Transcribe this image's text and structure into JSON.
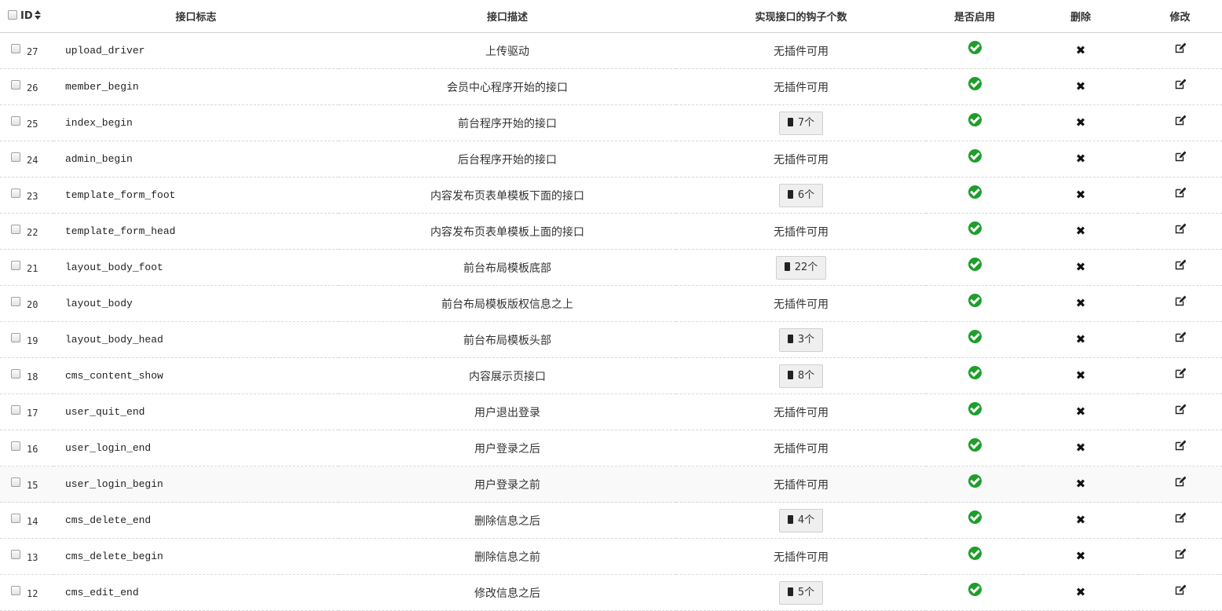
{
  "headers": {
    "id": "ID",
    "mark": "接口标志",
    "desc": "接口描述",
    "hooks": "实现接口的钩子个数",
    "enabled": "是否启用",
    "delete": "删除",
    "edit": "修改"
  },
  "rows": [
    {
      "id": "27",
      "mark": "upload_driver",
      "desc": "上传驱动",
      "hooks": "无插件可用",
      "hook_button": false,
      "enabled": true
    },
    {
      "id": "26",
      "mark": "member_begin",
      "desc": "会员中心程序开始的接口",
      "hooks": "无插件可用",
      "hook_button": false,
      "enabled": true
    },
    {
      "id": "25",
      "mark": "index_begin",
      "desc": "前台程序开始的接口",
      "hooks": "7个",
      "hook_button": true,
      "enabled": true
    },
    {
      "id": "24",
      "mark": "admin_begin",
      "desc": "后台程序开始的接口",
      "hooks": "无插件可用",
      "hook_button": false,
      "enabled": true
    },
    {
      "id": "23",
      "mark": "template_form_foot",
      "desc": "内容发布页表单模板下面的接口",
      "hooks": "6个",
      "hook_button": true,
      "enabled": true
    },
    {
      "id": "22",
      "mark": "template_form_head",
      "desc": "内容发布页表单模板上面的接口",
      "hooks": "无插件可用",
      "hook_button": false,
      "enabled": true
    },
    {
      "id": "21",
      "mark": "layout_body_foot",
      "desc": "前台布局模板底部",
      "hooks": "22个",
      "hook_button": true,
      "enabled": true
    },
    {
      "id": "20",
      "mark": "layout_body",
      "desc": "前台布局模板版权信息之上",
      "hooks": "无插件可用",
      "hook_button": false,
      "enabled": true
    },
    {
      "id": "19",
      "mark": "layout_body_head",
      "desc": "前台布局模板头部",
      "hooks": "3个",
      "hook_button": true,
      "enabled": true
    },
    {
      "id": "18",
      "mark": "cms_content_show",
      "desc": "内容展示页接口",
      "hooks": "8个",
      "hook_button": true,
      "enabled": true
    },
    {
      "id": "17",
      "mark": "user_quit_end",
      "desc": "用户退出登录",
      "hooks": "无插件可用",
      "hook_button": false,
      "enabled": true
    },
    {
      "id": "16",
      "mark": "user_login_end",
      "desc": "用户登录之后",
      "hooks": "无插件可用",
      "hook_button": false,
      "enabled": true
    },
    {
      "id": "15",
      "mark": "user_login_begin",
      "desc": "用户登录之前",
      "hooks": "无插件可用",
      "hook_button": false,
      "enabled": true
    },
    {
      "id": "14",
      "mark": "cms_delete_end",
      "desc": "删除信息之后",
      "hooks": "4个",
      "hook_button": true,
      "enabled": true
    },
    {
      "id": "13",
      "mark": "cms_delete_begin",
      "desc": "删除信息之前",
      "hooks": "无插件可用",
      "hook_button": false,
      "enabled": true
    },
    {
      "id": "12",
      "mark": "cms_edit_end",
      "desc": "修改信息之后",
      "hooks": "5个",
      "hook_button": true,
      "enabled": true
    }
  ],
  "icons": {
    "sort": "sort-icon",
    "enabled": "check-circle-icon",
    "delete": "times-icon",
    "edit": "edit-icon",
    "hooks": "chip-icon"
  },
  "colors": {
    "enabled_green": "#1e9e2b",
    "hovered_row": "#f9f9f9"
  }
}
